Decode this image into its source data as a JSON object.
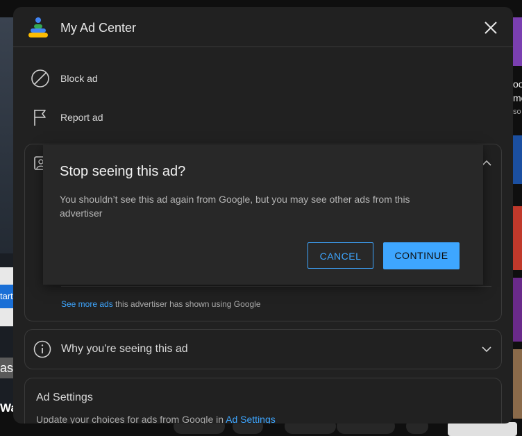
{
  "panel": {
    "title": "My Ad Center",
    "menu": [
      {
        "label": "Block ad",
        "icon": "block-icon"
      },
      {
        "label": "Report ad",
        "icon": "flag-icon"
      }
    ]
  },
  "advertiser_card": {
    "see_more_link": "See more ads",
    "see_more_rest": " this advertiser has shown using Google"
  },
  "why_card": {
    "label": "Why you're seeing this ad"
  },
  "settings_card": {
    "title": "Ad Settings",
    "desc_prefix": "Update your choices for ads from Google in ",
    "desc_link": "Ad Settings"
  },
  "dialog": {
    "title": "Stop seeing this ad?",
    "body": "You shouldn’t see this ad again from Google, but you may see other ads from this advertiser",
    "cancel_label": "CANCEL",
    "continue_label": "CONTINUE"
  },
  "background": {
    "left_button_fragment": "tart",
    "left_fragment_1": "as",
    "left_fragment_2": "Wa",
    "right_fragment_1": "oo",
    "right_fragment_2": "me",
    "right_fragment_3": "so"
  },
  "colors": {
    "accent": "#3ea6ff",
    "panel_bg": "#212121",
    "dialog_bg": "#282828"
  }
}
